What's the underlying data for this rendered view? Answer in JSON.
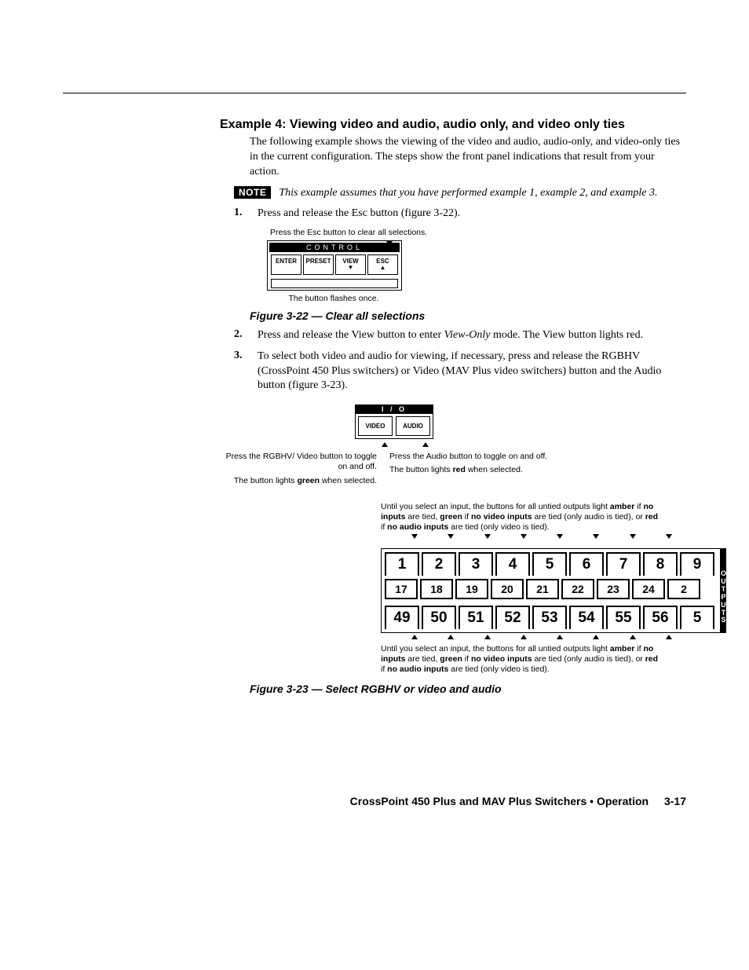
{
  "heading": "Example 4: Viewing video and audio, audio only, and video only ties",
  "intro": "The following example shows the viewing of the video and audio, audio-only, and video-only ties in the current configuration.  The steps show the front panel indications that result from your action.",
  "note_badge": "NOTE",
  "note_text": "This example assumes that you have performed example 1, example 2, and example 3.",
  "steps": {
    "s1": {
      "num": "1.",
      "text": "Press and release the Esc button (figure 3-22)."
    },
    "s2": {
      "num": "2.",
      "text_pre": "Press and release the View button to enter ",
      "text_em": "View-Only",
      "text_post": " mode.  The View button lights red."
    },
    "s3": {
      "num": "3.",
      "text": "To select both video and audio for viewing, if necessary, press and release the RGBHV (CrossPoint 450 Plus switchers) or Video (MAV Plus video switchers) button and the Audio button (figure 3-23)."
    }
  },
  "fig22": {
    "top_label": "Press the Esc button to clear all selections.",
    "panel_title": "CONTROL",
    "btns": {
      "enter": "ENTER",
      "preset": "PRESET",
      "view": "VIEW",
      "esc": "ESC"
    },
    "bot_label": "The button flashes once.",
    "caption": "Figure 3-22 — Clear all selections"
  },
  "fig23": {
    "io_header": "I / O",
    "video_btn": "VIDEO",
    "audio_btn": "AUDIO",
    "left_call_l1": "Press the RGBHV/ Video button to toggle on and off.",
    "left_call_l2_pre": "The button lights ",
    "left_call_l2_strong": "green",
    "left_call_l2_post": " when selected.",
    "right_call_l1": "Press the Audio button to toggle on and off.",
    "right_call_l2_pre": "The button lights ",
    "right_call_l2_strong": "red",
    "right_call_l2_post": " when selected.",
    "indication_pre": "Until you select an input, the buttons for all untied outputs light ",
    "ind_amber": "amber",
    "ind_t1": " if ",
    "ind_noin": "no inputs",
    "ind_t2": " are tied, ",
    "ind_green": "green",
    "ind_t3": " if ",
    "ind_novid": "no video inputs",
    "ind_t4": " are tied (only audio is tied), or ",
    "ind_red": "red",
    "ind_t5": " if ",
    "ind_noaud": "no audio inputs",
    "ind_t6": " are tied (only video is tied).",
    "row1": [
      "1",
      "2",
      "3",
      "4",
      "5",
      "6",
      "7",
      "8",
      "9"
    ],
    "row2": [
      "17",
      "18",
      "19",
      "20",
      "21",
      "22",
      "23",
      "24",
      "2"
    ],
    "row3": [
      "49",
      "50",
      "51",
      "52",
      "53",
      "54",
      "55",
      "56",
      "5"
    ],
    "side_label": "OUTPUTS",
    "caption": "Figure 3-23 — Select RGBHV or video and audio"
  },
  "footer": {
    "title": "CrossPoint 450 Plus and MAV Plus Switchers • Operation",
    "page": "3-17"
  }
}
